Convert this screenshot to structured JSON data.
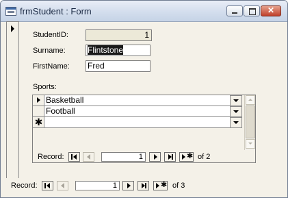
{
  "window": {
    "title": "frmStudent : Form",
    "close_glyph": "✕",
    "icon": "form-icon"
  },
  "fields": {
    "student_id": {
      "label": "StudentID:",
      "value": "1"
    },
    "surname": {
      "label": "Surname:",
      "value": "Flintstone"
    },
    "first_name": {
      "label": "FirstName:",
      "value": "Fred"
    }
  },
  "sports": {
    "label": "Sports:",
    "rows": [
      "Basketball",
      "Football",
      ""
    ],
    "new_row_glyph": "✱",
    "nav": {
      "label": "Record:",
      "current": "1",
      "of_text": "of 2"
    }
  },
  "nav": {
    "label": "Record:",
    "current": "1",
    "of_text": "of 3",
    "new_glyph": "✱"
  }
}
